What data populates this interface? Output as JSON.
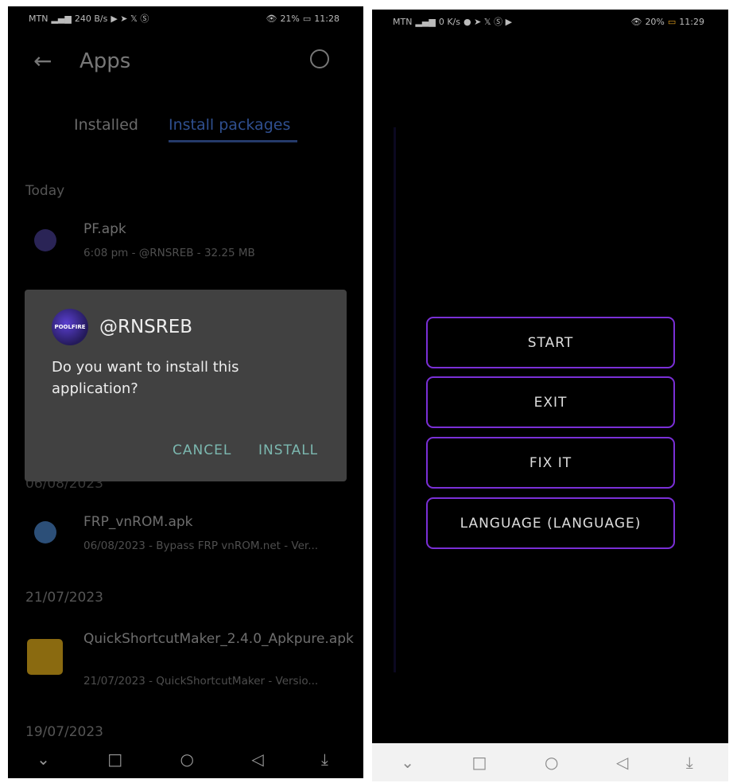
{
  "left": {
    "status": {
      "carrier": "MTN",
      "speed": "240 B/s",
      "battery": "21%",
      "time": "11:28"
    },
    "header": {
      "title": "Apps"
    },
    "tabs": [
      {
        "label": "Installed"
      },
      {
        "label": "Install packages",
        "active": true
      }
    ],
    "sections": [
      {
        "label": "Today",
        "items": [
          {
            "name": "PF.apk",
            "sub": "6:08 pm - @RNSREB - 32.25 MB"
          }
        ]
      },
      {
        "label": "06/08/2023",
        "items": [
          {
            "name": "FRP_vnROM.apk",
            "sub": "06/08/2023 - Bypass FRP vnROM.net - Ver..."
          }
        ]
      },
      {
        "label": "21/07/2023",
        "items": [
          {
            "name": "QuickShortcutMaker_2.4.0_Apkpure.apk",
            "sub": "21/07/2023 - QuickShortcutMaker - Versio..."
          }
        ]
      },
      {
        "label": "19/07/2023"
      }
    ],
    "dialog": {
      "avatar_text": "POOLFIRE",
      "publisher": "@RNSREB",
      "message": "Do you want to install this application?",
      "cancel": "CANCEL",
      "install": "INSTALL",
      "accent": "#7cb8b0"
    }
  },
  "right": {
    "status": {
      "carrier": "MTN",
      "speed": "0 K/s",
      "battery": "20%",
      "time": "11:29"
    },
    "buttons": [
      {
        "label": "START"
      },
      {
        "label": "EXIT"
      },
      {
        "label": "FIX IT"
      },
      {
        "label": "LANGUAGE (LANGUAGE)"
      }
    ],
    "accent": "#7a2fd6"
  },
  "nav_icons": [
    "chevron-down-icon",
    "square-icon",
    "circle-icon",
    "triangle-back-icon",
    "download-icon"
  ]
}
